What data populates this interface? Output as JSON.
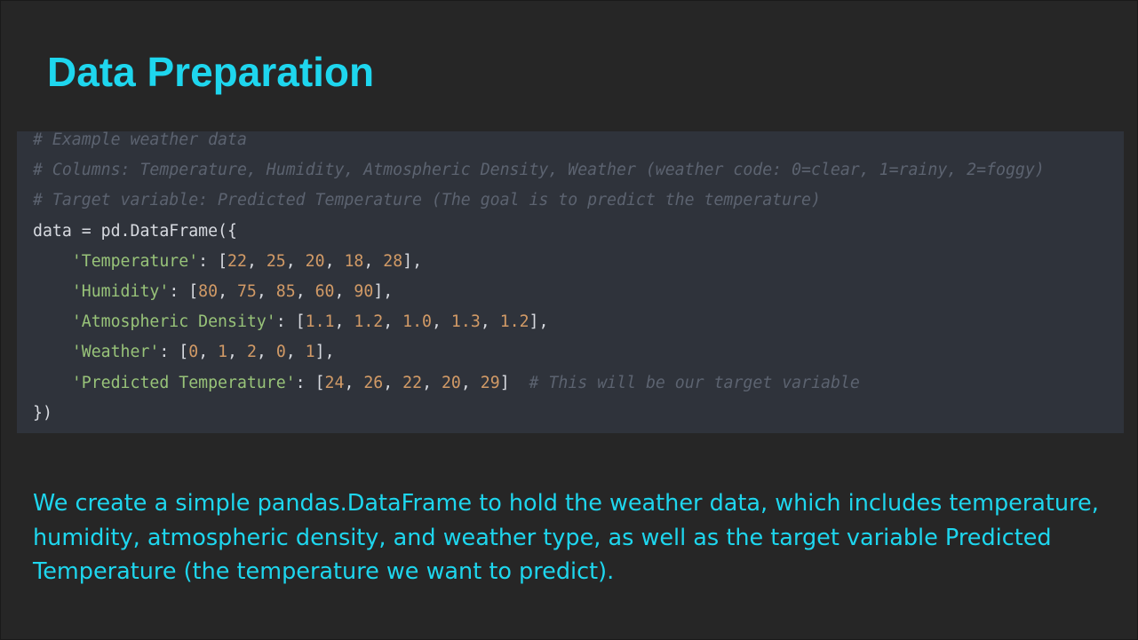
{
  "slide": {
    "title": "Data Preparation",
    "code": {
      "comment_1": "# Example weather data",
      "comment_2": "# Columns: Temperature, Humidity, Atmospheric Density, Weather (weather code: 0=clear, 1=rainy, 2=foggy)",
      "comment_3": "# Target variable: Predicted Temperature (The goal is to predict the temperature)",
      "line_4": "data = pd.DataFrame({",
      "indent": "    ",
      "rows": [
        {
          "key": "'Temperature'",
          "sep": ": [",
          "values": [
            "22",
            "25",
            "20",
            "18",
            "28"
          ],
          "end": "],"
        },
        {
          "key": "'Humidity'",
          "sep": ": [",
          "values": [
            "80",
            "75",
            "85",
            "60",
            "90"
          ],
          "end": "],"
        },
        {
          "key": "'Atmospheric Density'",
          "sep": ": [",
          "values": [
            "1.1",
            "1.2",
            "1.0",
            "1.3",
            "1.2"
          ],
          "end": "],"
        },
        {
          "key": "'Weather'",
          "sep": ": [",
          "values": [
            "0",
            "1",
            "2",
            "0",
            "1"
          ],
          "end": "],"
        },
        {
          "key": "'Predicted Temperature'",
          "sep": ": [",
          "values": [
            "24",
            "26",
            "22",
            "20",
            "29"
          ],
          "end": "]",
          "trailing_comment": "  # This will be our target variable"
        }
      ],
      "value_separator": ", ",
      "closing_line": "})"
    },
    "description": "We create a simple pandas.DataFrame to hold the weather data, which includes temperature, humidity, atmospheric density, and weather type, as well as the target variable Predicted Temperature (the temperature we want to predict)."
  },
  "colors": {
    "background": "#262626",
    "accent": "#1ed6ee",
    "code_background": "#2f333b",
    "comment": "#5c6370",
    "string": "#98c379",
    "number": "#d19a66",
    "text": "#d7dae0"
  }
}
